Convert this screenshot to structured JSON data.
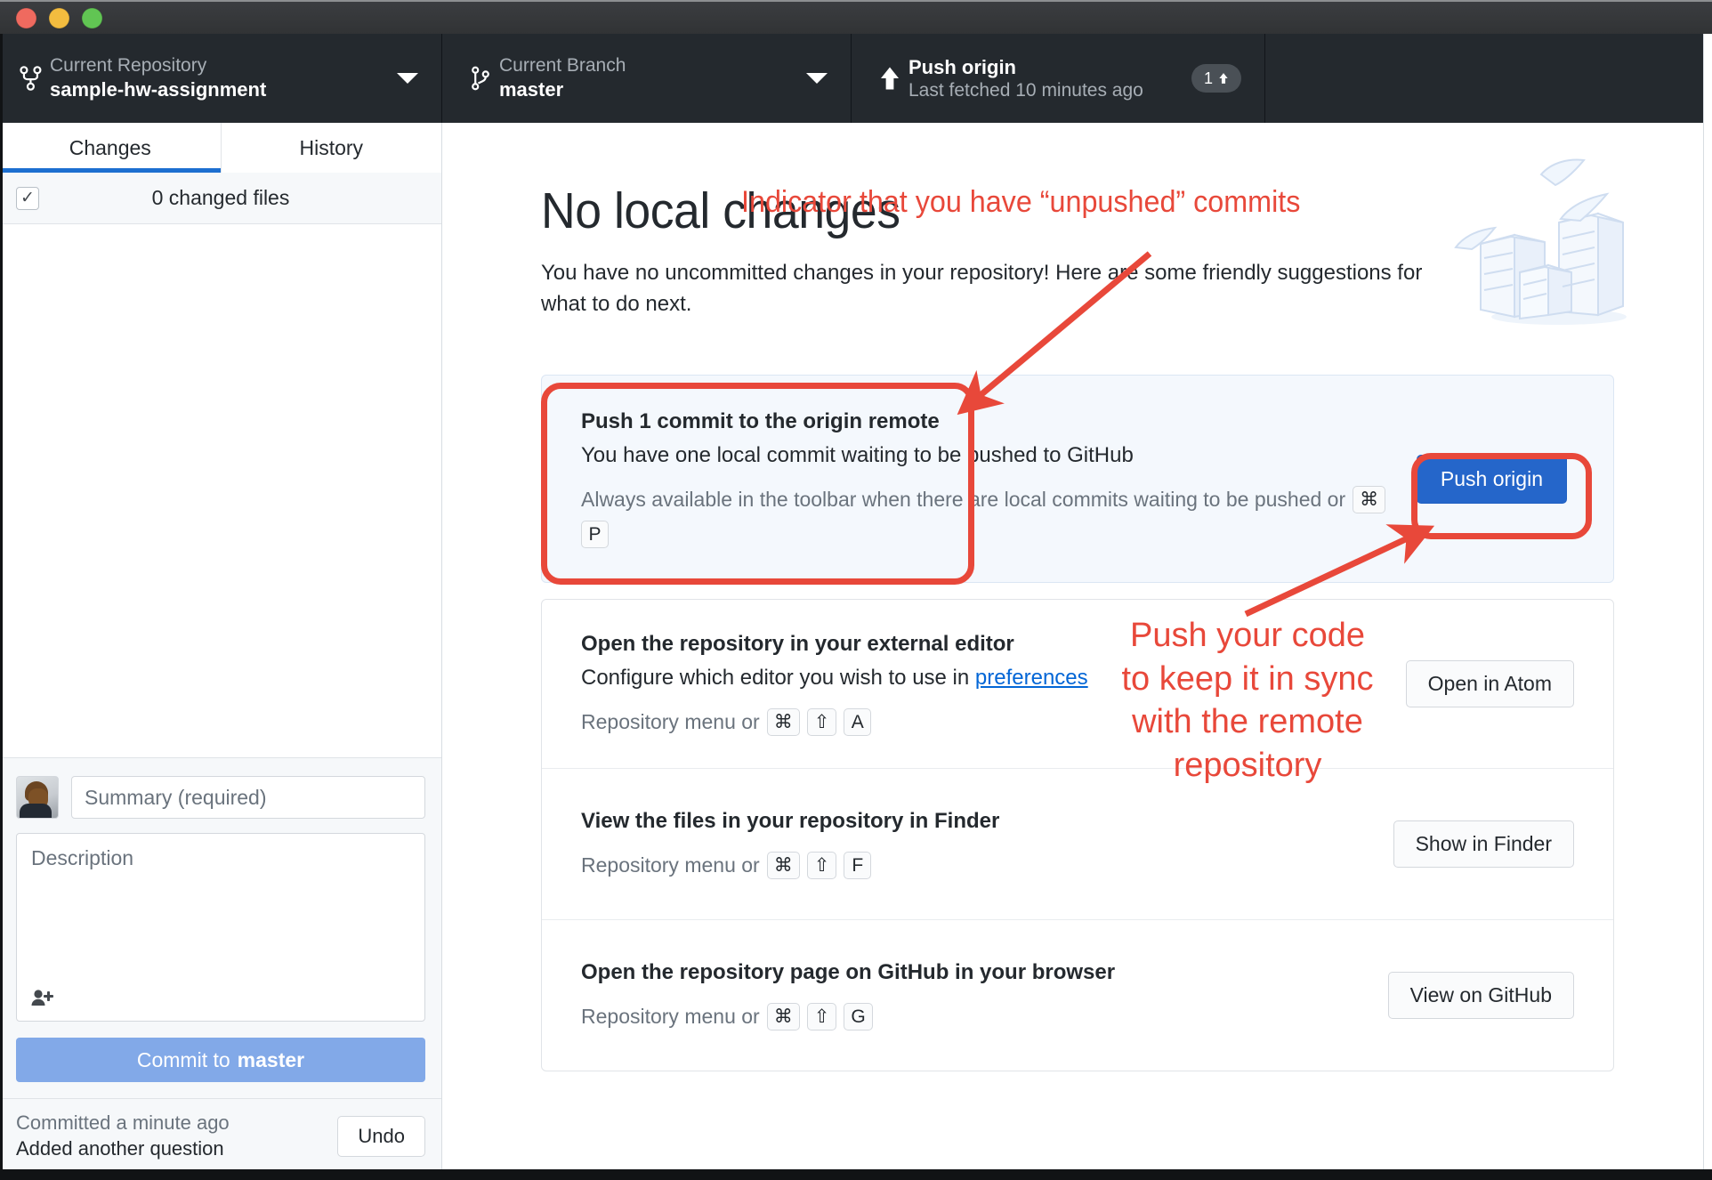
{
  "window": {
    "traffic_lights": [
      "close",
      "minimize",
      "zoom"
    ]
  },
  "toolbar": {
    "repository": {
      "label": "Current Repository",
      "value": "sample-hw-assignment",
      "icon": "repo-icon",
      "caret": "chevron-down-icon"
    },
    "branch": {
      "label": "Current Branch",
      "value": "master",
      "icon": "branch-icon",
      "caret": "chevron-down-icon"
    },
    "push": {
      "label": "Push origin",
      "value": "Last fetched 10 minutes ago",
      "icon": "arrow-up-icon",
      "ahead_count": "1",
      "ahead_icon": "arrow-up-icon"
    }
  },
  "sidebar": {
    "tabs": [
      {
        "label": "Changes",
        "active": true
      },
      {
        "label": "History",
        "active": false
      }
    ],
    "changed_files_label": "0 changed files",
    "checkbox_glyph": "✓",
    "commit_form": {
      "summary_placeholder": "Summary (required)",
      "summary_value": "",
      "description_placeholder": "Description",
      "description_value": "",
      "add_coauthor_icon": "add-person-icon",
      "commit_button_prefix": "Commit to ",
      "commit_button_branch": "master"
    },
    "undo_bar": {
      "status": "Committed a minute ago",
      "message": "Added another question",
      "undo_label": "Undo"
    }
  },
  "main": {
    "title": "No local changes",
    "subtitle": "You have no uncommitted changes in your repository! Here are some friendly suggestions for what to do next.",
    "illustration": "stacked-boxes-illustration",
    "primary_suggestion": {
      "title": "Push 1 commit to the origin remote",
      "description": "You have one local commit waiting to be pushed to GitHub",
      "meta_prefix": "Always available in the toolbar when there are local commits waiting to be pushed or ",
      "keys": [
        "⌘",
        "P"
      ],
      "button_label": "Push origin"
    },
    "suggestions": [
      {
        "title": "Open the repository in your external editor",
        "description_prefix": "Configure which editor you wish to use in ",
        "description_link": "preferences",
        "meta_prefix": "Repository menu or ",
        "keys": [
          "⌘",
          "⇧",
          "A"
        ],
        "button_label": "Open in Atom"
      },
      {
        "title": "View the files in your repository in Finder",
        "description_prefix": "",
        "description_link": "",
        "meta_prefix": "Repository menu or ",
        "keys": [
          "⌘",
          "⇧",
          "F"
        ],
        "button_label": "Show in Finder"
      },
      {
        "title": "Open the repository page on GitHub in your browser",
        "description_prefix": "",
        "description_link": "",
        "meta_prefix": "Repository menu or ",
        "keys": [
          "⌘",
          "⇧",
          "G"
        ],
        "button_label": "View on GitHub"
      }
    ]
  },
  "annotations": {
    "color": "#e8483a",
    "top_note": "Indicator that you have “unpushed” commits",
    "right_note": "Push your code\nto keep it in sync\nwith the remote\nrepository"
  },
  "colors": {
    "toolbar_bg": "#24292e",
    "accent_blue": "#2566ca",
    "tab_underline": "#1d6fd0",
    "annotation_red": "#e8483a",
    "link_blue": "#0366d6",
    "commit_button": "#82a9e8"
  }
}
